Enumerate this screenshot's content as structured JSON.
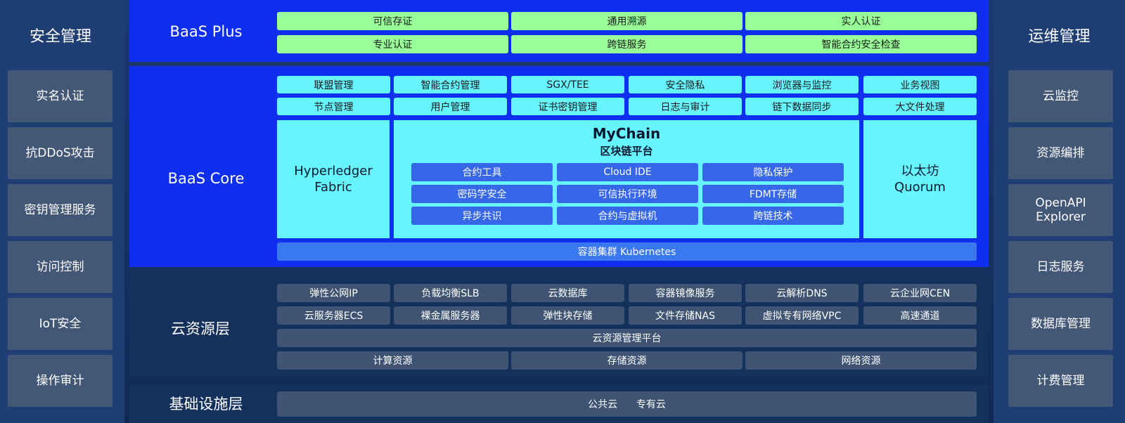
{
  "left_panel": {
    "title": "安全管理",
    "items": [
      "实名认证",
      "抗DDoS攻击",
      "密钥管理服务",
      "访问控制",
      "IoT安全",
      "操作审计"
    ]
  },
  "right_panel": {
    "title": "运维管理",
    "items": [
      "云监控",
      "资源编排",
      "OpenAPI\nExplorer",
      "日志服务",
      "数据库管理",
      "计费管理"
    ]
  },
  "baas_plus": {
    "label": "BaaS Plus",
    "row1": [
      "可信存证",
      "通用溯源",
      "实人认证"
    ],
    "row2": [
      "专业认证",
      "跨链服务",
      "智能合约安全检查"
    ]
  },
  "baas_core": {
    "label": "BaaS Core",
    "row1": [
      "联盟管理",
      "智能合约管理",
      "SGX/TEE",
      "安全隐私",
      "浏览器与监控",
      "业务视图"
    ],
    "row2": [
      "节点管理",
      "用户管理",
      "证书密钥管理",
      "日志与审计",
      "链下数据同步",
      "大文件处理"
    ],
    "hyperledger": "Hyperledger\nFabric",
    "mychain_title": "MyChain",
    "mychain_subtitle": "区块链平台",
    "mychain_items": [
      "合约工具",
      "Cloud IDE",
      "隐私保护",
      "密码学安全",
      "可信执行环境",
      "FDMT存储",
      "异步共识",
      "合约与虚拟机",
      "跨链技术"
    ],
    "ethereum": "以太坊\nQuorum",
    "kubernetes": "容器集群 Kubernetes"
  },
  "cloud_layer": {
    "label": "云资源层",
    "row1": [
      "弹性公网IP",
      "负载均衡SLB",
      "云数据库",
      "容器镜像服务",
      "云解析DNS",
      "云企业网CEN"
    ],
    "row2": [
      "云服务器ECS",
      "裸金属服务器",
      "弹性块存储",
      "文件存储NAS",
      "虚拟专有网络VPC",
      "高速通道"
    ],
    "platform": "云资源管理平台",
    "resources": [
      "计算资源",
      "存储资源",
      "网络资源"
    ]
  },
  "infra_layer": {
    "label": "基础设施层",
    "content": "公共云      专有云"
  },
  "colors": {
    "baas_band": "#0f2ff0",
    "green_cell": "#99ff99",
    "cyan_cell": "#66f5ff",
    "blue_cell": "#3667e8",
    "slate_cell": "#3f5473",
    "dark_band": "#14315c"
  }
}
